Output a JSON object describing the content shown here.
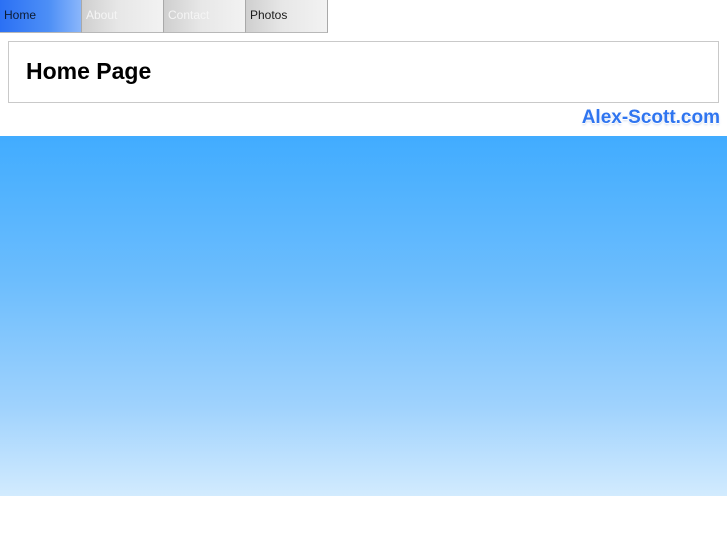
{
  "nav": {
    "tabs": [
      {
        "label": "Home"
      },
      {
        "label": "About"
      },
      {
        "label": "Contact"
      },
      {
        "label": "Photos"
      }
    ],
    "active": "Home"
  },
  "header": {
    "title": "Home Page"
  },
  "brand": {
    "text": "Alex-Scott.com",
    "color": "#2f75f0"
  },
  "hero": {
    "gradient_top": "#41acff",
    "gradient_bottom": "#d2ebfe"
  }
}
